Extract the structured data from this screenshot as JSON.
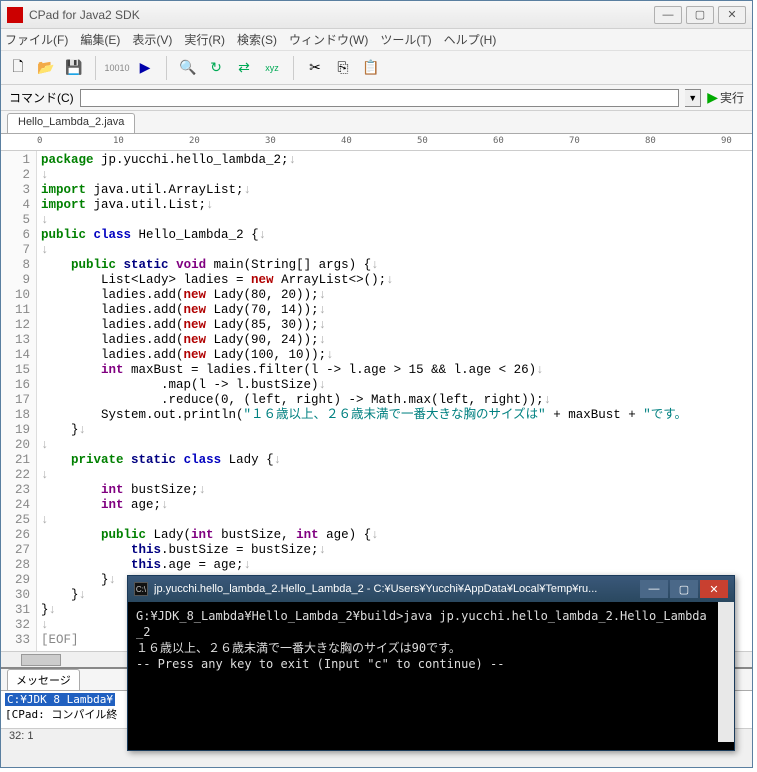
{
  "window": {
    "title": "CPad for Java2 SDK"
  },
  "menu": {
    "file": "ファイル(F)",
    "edit": "編集(E)",
    "view": "表示(V)",
    "run": "実行(R)",
    "search": "検索(S)",
    "window": "ウィンドウ(W)",
    "tool": "ツール(T)",
    "help": "ヘルプ(H)"
  },
  "cmd": {
    "label": "コマンド(C)",
    "value": "",
    "run": "実行"
  },
  "tab": {
    "file": "Hello_Lambda_2.java"
  },
  "ruler": {
    "t0": "0",
    "t10": "10",
    "t20": "20",
    "t30": "30",
    "t40": "40",
    "t50": "50",
    "t60": "60",
    "t70": "70",
    "t80": "80",
    "t90": "90"
  },
  "code": {
    "l1": {
      "kw": "package",
      "rest": " jp.yucchi.hello_lambda_2;"
    },
    "l3a": {
      "kw": "import",
      "rest": " java.util.ArrayList;"
    },
    "l3b": {
      "kw": "import",
      "rest": " java.util.List;"
    },
    "l6": {
      "kw1": "public",
      "kw2": "class",
      "name": " Hello_Lambda_2 {"
    },
    "l8": {
      "k1": "public",
      "k2": "static",
      "k3": "void",
      "rest": " main(String[] args) {"
    },
    "l9": {
      "pre": "        List<Lady> ladies = ",
      "kw": "new",
      "rest": " ArrayList<>();"
    },
    "l10": {
      "pre": "        ladies.add(",
      "kw": "new",
      "rest": " Lady(80, 20));"
    },
    "l11": {
      "pre": "        ladies.add(",
      "kw": "new",
      "rest": " Lady(70, 14));"
    },
    "l12": {
      "pre": "        ladies.add(",
      "kw": "new",
      "rest": " Lady(85, 30));"
    },
    "l13": {
      "pre": "        ladies.add(",
      "kw": "new",
      "rest": " Lady(90, 24));"
    },
    "l14": {
      "pre": "        ladies.add(",
      "kw": "new",
      "rest": " Lady(100, 10));"
    },
    "l15": {
      "pre": "        ",
      "kw": "int",
      "rest": " maxBust = ladies.filter(l -> l.age > 15 && l.age < 26)"
    },
    "l16": "                .map(l -> l.bustSize)",
    "l17": "                .reduce(0, (left, right) -> Math.max(left, right));",
    "l18": {
      "pre": "        System.out.println(",
      "str": "\"１６歳以上、２６歳未満で一番大きな胸のサイズは\"",
      "mid": " + maxBust + ",
      "str2": "\"です。"
    },
    "l19": "    }",
    "l21": {
      "k1": "private",
      "k2": "static",
      "k3": "class",
      "rest": " Lady {"
    },
    "l23": {
      "pre": "        ",
      "k": "int",
      "rest": " bustSize;"
    },
    "l24": {
      "pre": "        ",
      "k": "int",
      "rest": " age;"
    },
    "l26": {
      "pre": "        ",
      "k1": "public",
      "name": " Lady(",
      "k2": "int",
      "mid": " bustSize, ",
      "k3": "int",
      "rest": " age) {"
    },
    "l27": {
      "pre": "            ",
      "k": "this",
      "rest": ".bustSize = bustSize;"
    },
    "l28": {
      "pre": "            ",
      "k": "this",
      "rest": ".age = age;"
    },
    "l29": "        }",
    "l30": "    }",
    "l31": "}",
    "l33": "[EOF]"
  },
  "msg": {
    "tab": "メッセージ",
    "line1": "C:¥JDK 8 Lambda¥",
    "line2": "[CPad: コンパイル終"
  },
  "status": {
    "pos": "32: 1"
  },
  "console": {
    "title": "jp.yucchi.hello_lambda_2.Hello_Lambda_2 - C:¥Users¥Yucchi¥AppData¥Local¥Temp¥ru...",
    "l1": "G:¥JDK_8_Lambda¥Hello_Lambda_2¥build>java jp.yucchi.hello_lambda_2.Hello_Lambda_2",
    "l2": "１６歳以上、２６歳未満で一番大きな胸のサイズは90です。",
    "l3": "-- Press any key to exit (Input \"c\" to continue) --"
  }
}
